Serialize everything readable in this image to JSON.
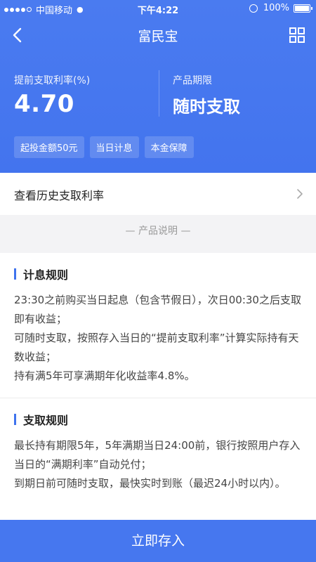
{
  "status_bar": {
    "carrier": "中国移动",
    "time": "下午4:22",
    "battery": "100%"
  },
  "nav": {
    "title": "富民宝"
  },
  "rate": {
    "label": "提前支取利率(%)",
    "value": "4.70"
  },
  "term": {
    "label": "产品期限",
    "value": "随时支取"
  },
  "tags": [
    "起投金额50元",
    "当日计息",
    "本金保障"
  ],
  "history_link": "查看历史支取利率",
  "section_title": "— 产品说明 —",
  "interest_rules": {
    "title": "计息规则",
    "paragraphs": [
      "23:30之前购买当日起息（包含节假日），次日00:30之后支取即有收益；",
      "可随时支取，按照存入当日的“提前支取利率”计算实际持有天数收益；",
      "持有满5年可享满期年化收益率4.8%。"
    ]
  },
  "withdraw_rules": {
    "title": "支取规则",
    "paragraphs": [
      "最长持有期限5年，5年满期当日24:00前，银行按照用户存入当日的“满期利率”自动兑付；",
      "到期日前可随时支取，最快实时到账（最迟24小时以内）。"
    ]
  },
  "cta_label": "立即存入",
  "colors": {
    "primary": "#4677ef",
    "hero_top": "#4a7bf0",
    "accent_bar": "#3f73ee"
  }
}
